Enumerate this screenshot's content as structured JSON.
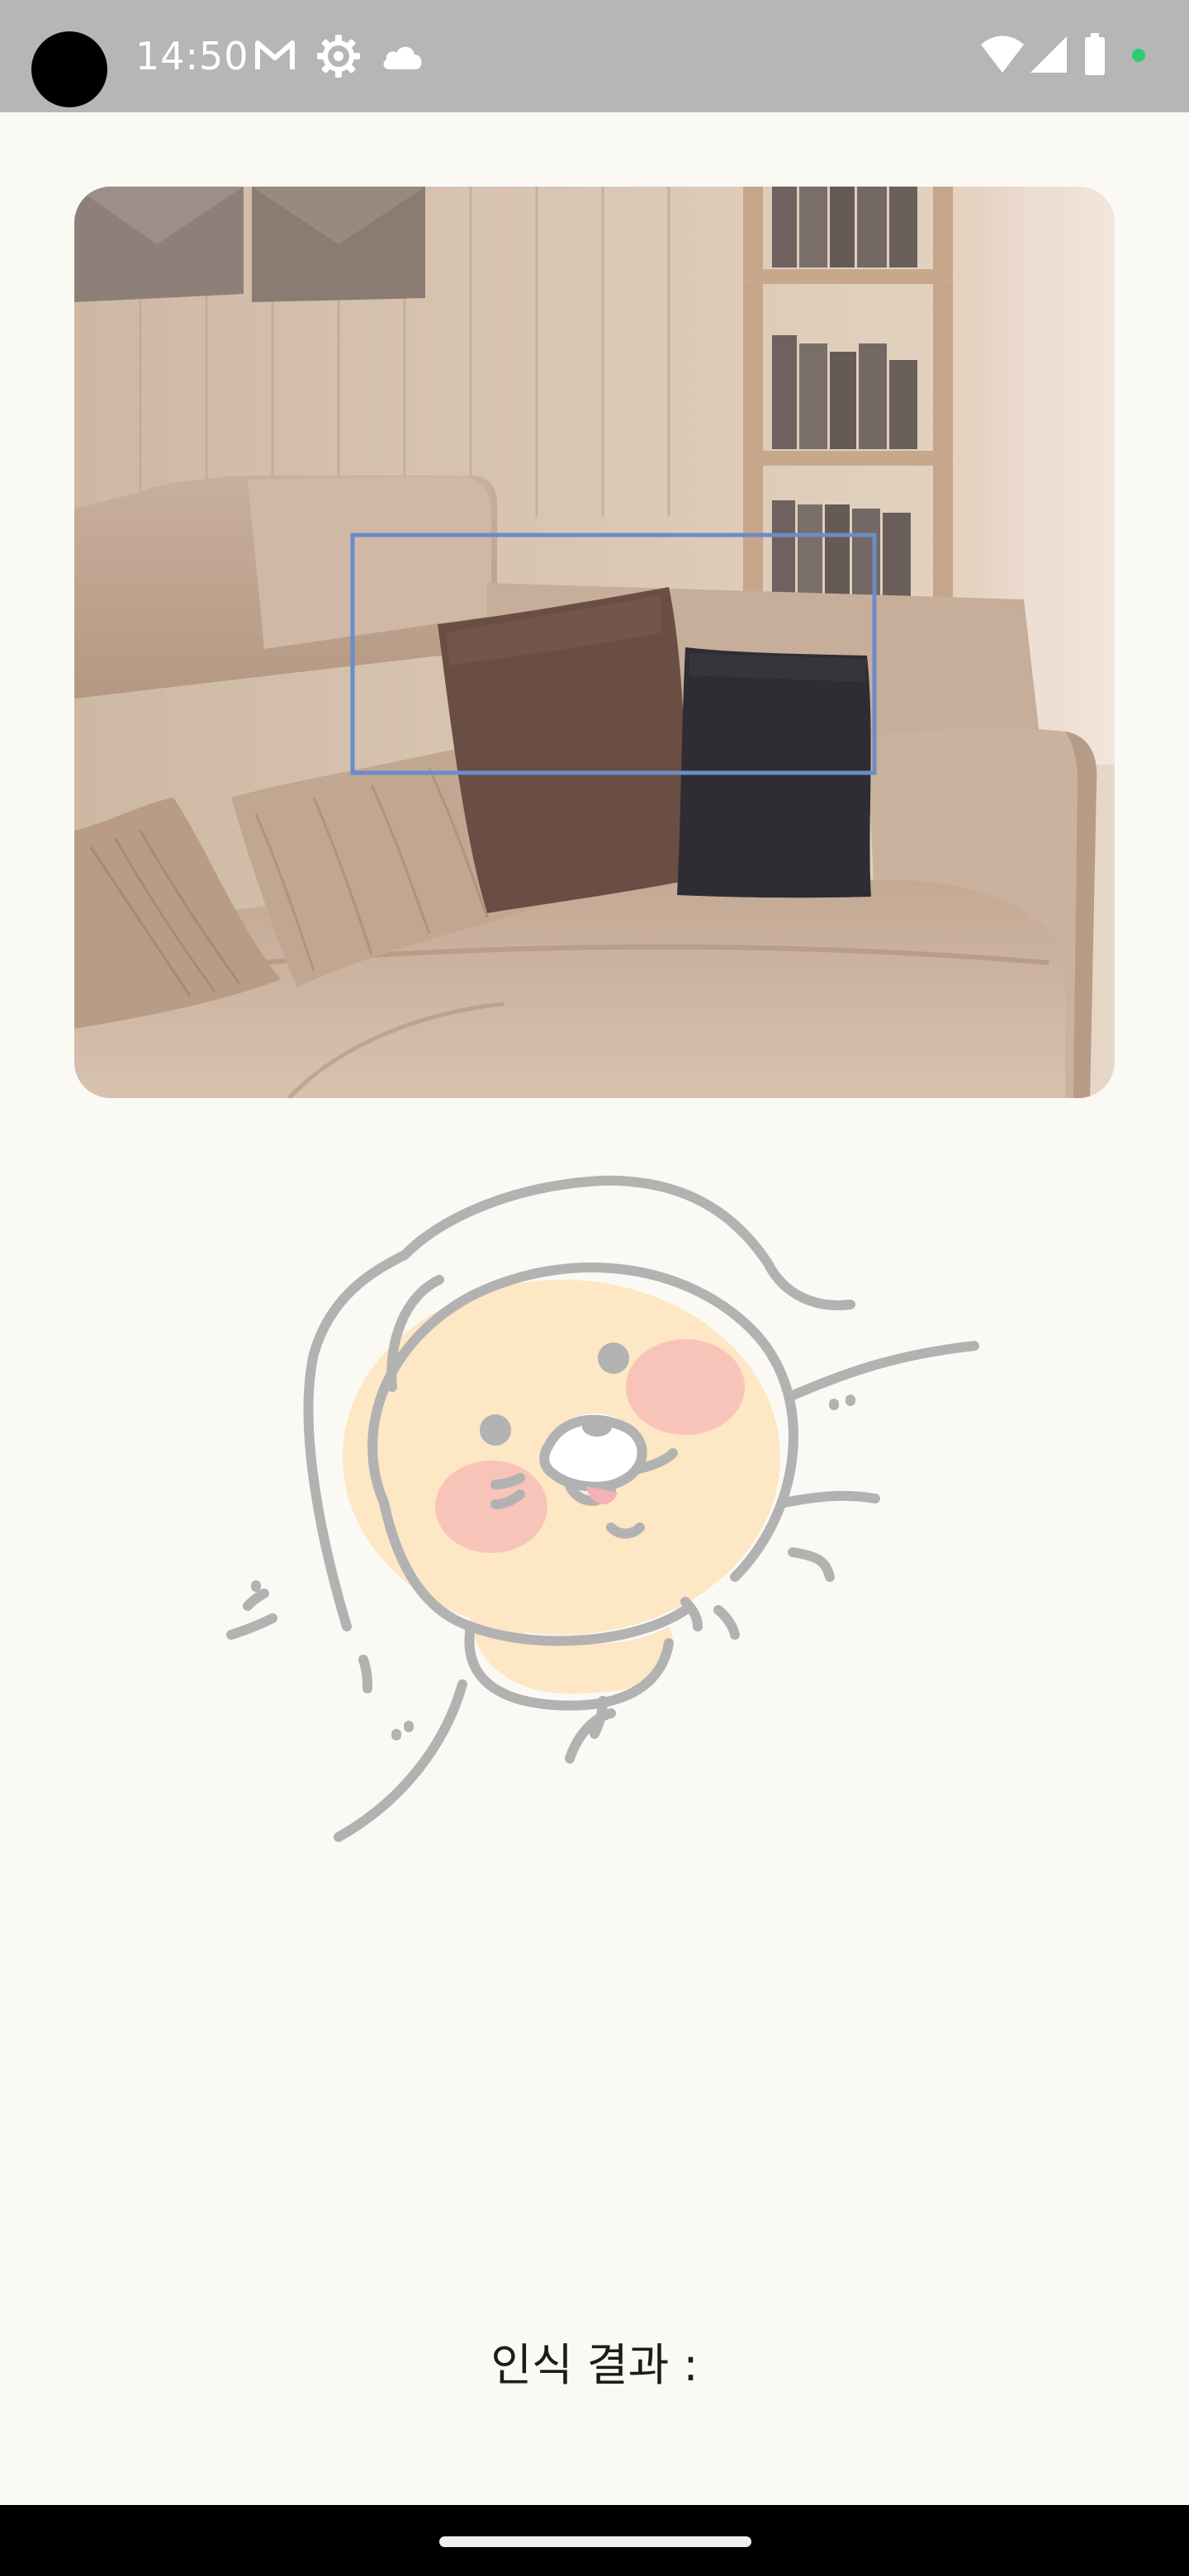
{
  "status_bar": {
    "time": "14:50",
    "left_icons": [
      "gmail-icon",
      "settings-gear-icon",
      "cloud-icon"
    ],
    "right_icons": [
      "wifi-icon",
      "cellular-signal-icon",
      "battery-icon",
      "privacy-indicator-dot"
    ],
    "indicator_color": "#2ecc71"
  },
  "main_image": {
    "icon": "sofa-photo",
    "detection_box_color": "#6b8cc9"
  },
  "mascot": {
    "icon": "cartoon-character-illustration"
  },
  "result": {
    "label": "인식 결과 :"
  },
  "nav_bar": {
    "icon": "home-handle"
  }
}
